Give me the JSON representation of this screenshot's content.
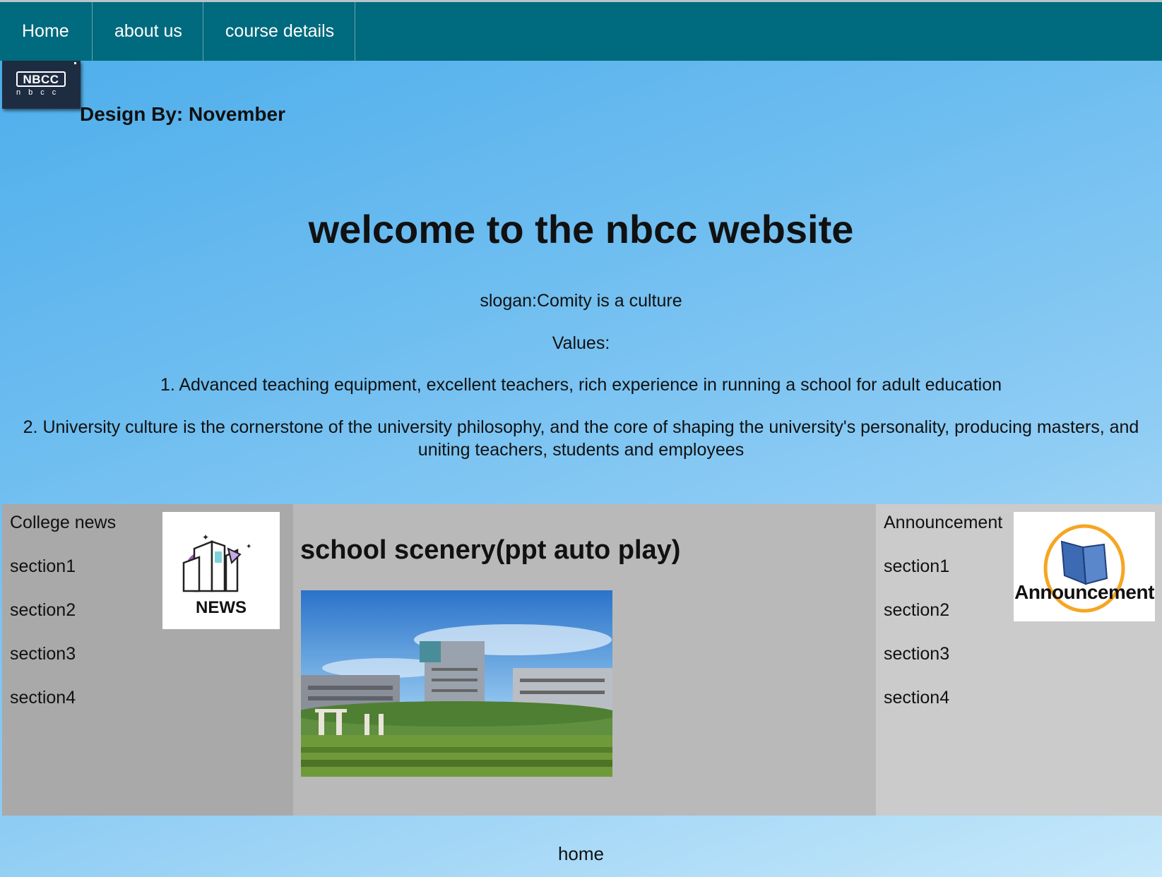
{
  "nav": {
    "items": [
      {
        "label": "Home"
      },
      {
        "label": "about us"
      },
      {
        "label": "course details"
      }
    ]
  },
  "logo": {
    "text": "NBCC",
    "sub": "nbcc"
  },
  "design_by": "Design By: November",
  "hero": {
    "title": "welcome to the nbcc website",
    "slogan": "slogan:Comity is a culture",
    "values_label": "Values:",
    "value1": "1. Advanced teaching equipment, excellent teachers, rich experience in running a school for adult education",
    "value2": "2. University culture is the cornerstone of the university philosophy, and the core of shaping the university's personality, producing masters, and uniting teachers, students and employees"
  },
  "news": {
    "heading": "College news",
    "sections": [
      "section1",
      "section2",
      "section3",
      "section4"
    ],
    "image_label": "NEWS"
  },
  "scenery": {
    "heading": "school scenery(ppt auto play)"
  },
  "announcement": {
    "heading": "Announcement",
    "sections": [
      "section1",
      "section2",
      "section3",
      "section4"
    ],
    "image_label": "Announcement"
  },
  "footer": {
    "link": "home"
  },
  "colors": {
    "nav_bg": "#006a7e",
    "left_panel": "#a9a9a9",
    "mid_panel": "#b9b9b9",
    "right_panel": "#cbcbcb"
  }
}
